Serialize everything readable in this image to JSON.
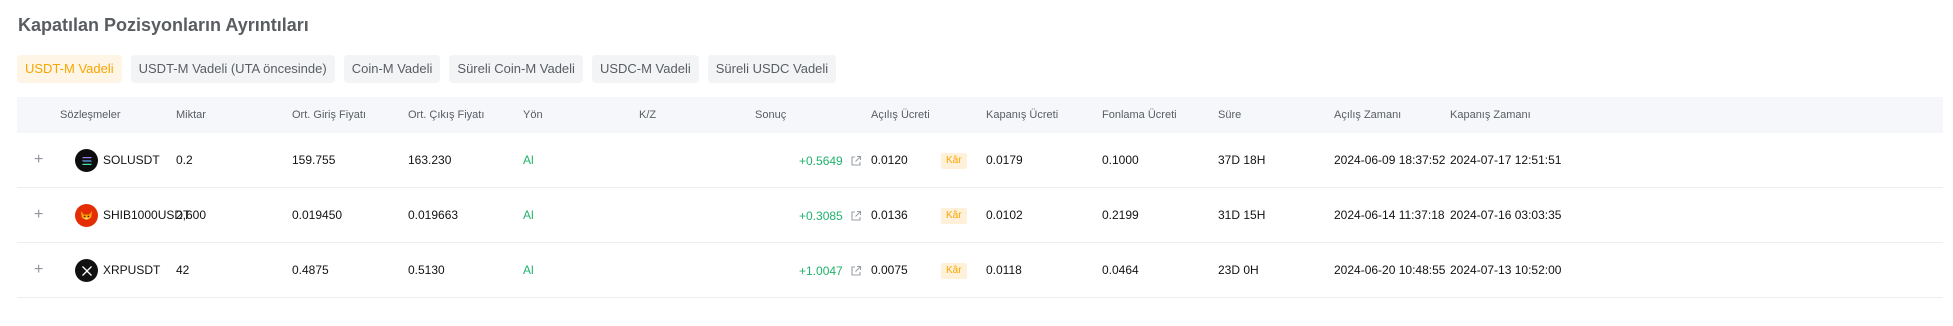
{
  "page": {
    "title": "Kapatılan Pozisyonların Ayrıntıları"
  },
  "tabs": [
    {
      "label": "USDT-M Vadeli",
      "active": true
    },
    {
      "label": "USDT-M Vadeli (UTA öncesinde)",
      "active": false
    },
    {
      "label": "Coin-M Vadeli",
      "active": false
    },
    {
      "label": "Süreli Coin-M Vadeli",
      "active": false
    },
    {
      "label": "USDC-M Vadeli",
      "active": false
    },
    {
      "label": "Süreli USDC Vadeli",
      "active": false
    }
  ],
  "table": {
    "headers": {
      "contracts": "Sözleşmeler",
      "qty": "Miktar",
      "entry": "Ort. Giriş Fiyatı",
      "exit": "Ort. Çıkış Fiyatı",
      "side": "Yön",
      "pnl": "K/Z",
      "result": "Sonuç",
      "open_fee": "Açılış Ücreti",
      "close_fee": "Kapanış Ücreti",
      "funding_fee": "Fonlama Ücreti",
      "duration": "Süre",
      "open_time": "Açılış Zamanı",
      "close_time": "Kapanış Zamanı"
    },
    "rows": [
      {
        "expand": "+",
        "coin_icon": "solana-icon",
        "symbol": "SOLUSDT",
        "qty": "0.2",
        "entry": "159.755",
        "exit": "163.230",
        "side": "Al",
        "pnl": "+0.5649",
        "result": "Kâr",
        "open_fee": "0.0120",
        "close_fee": "0.0179",
        "funding_fee": "0.1000",
        "duration": "37D 18H",
        "open_time": "2024-06-09 18:37:52",
        "close_time": "2024-07-17 12:51:51"
      },
      {
        "expand": "+",
        "coin_icon": "shiba-inu-icon",
        "symbol": "SHIB1000USDT",
        "qty": "2,600",
        "entry": "0.019450",
        "exit": "0.019663",
        "side": "Al",
        "pnl": "+0.3085",
        "result": "Kâr",
        "open_fee": "0.0136",
        "close_fee": "0.0102",
        "funding_fee": "0.2199",
        "duration": "31D 15H",
        "open_time": "2024-06-14 11:37:18",
        "close_time": "2024-07-16 03:03:35"
      },
      {
        "expand": "+",
        "coin_icon": "xrp-icon",
        "symbol": "XRPUSDT",
        "qty": "42",
        "entry": "0.4875",
        "exit": "0.5130",
        "side": "Al",
        "pnl": "+1.0047",
        "result": "Kâr",
        "open_fee": "0.0075",
        "close_fee": "0.0118",
        "funding_fee": "0.0464",
        "duration": "23D 0H",
        "open_time": "2024-06-20 10:48:55",
        "close_time": "2024-07-13 10:52:00"
      }
    ]
  },
  "colors": {
    "accent": "#f7a600",
    "profit": "#20b26c",
    "header_bg": "#f5f7fa"
  }
}
